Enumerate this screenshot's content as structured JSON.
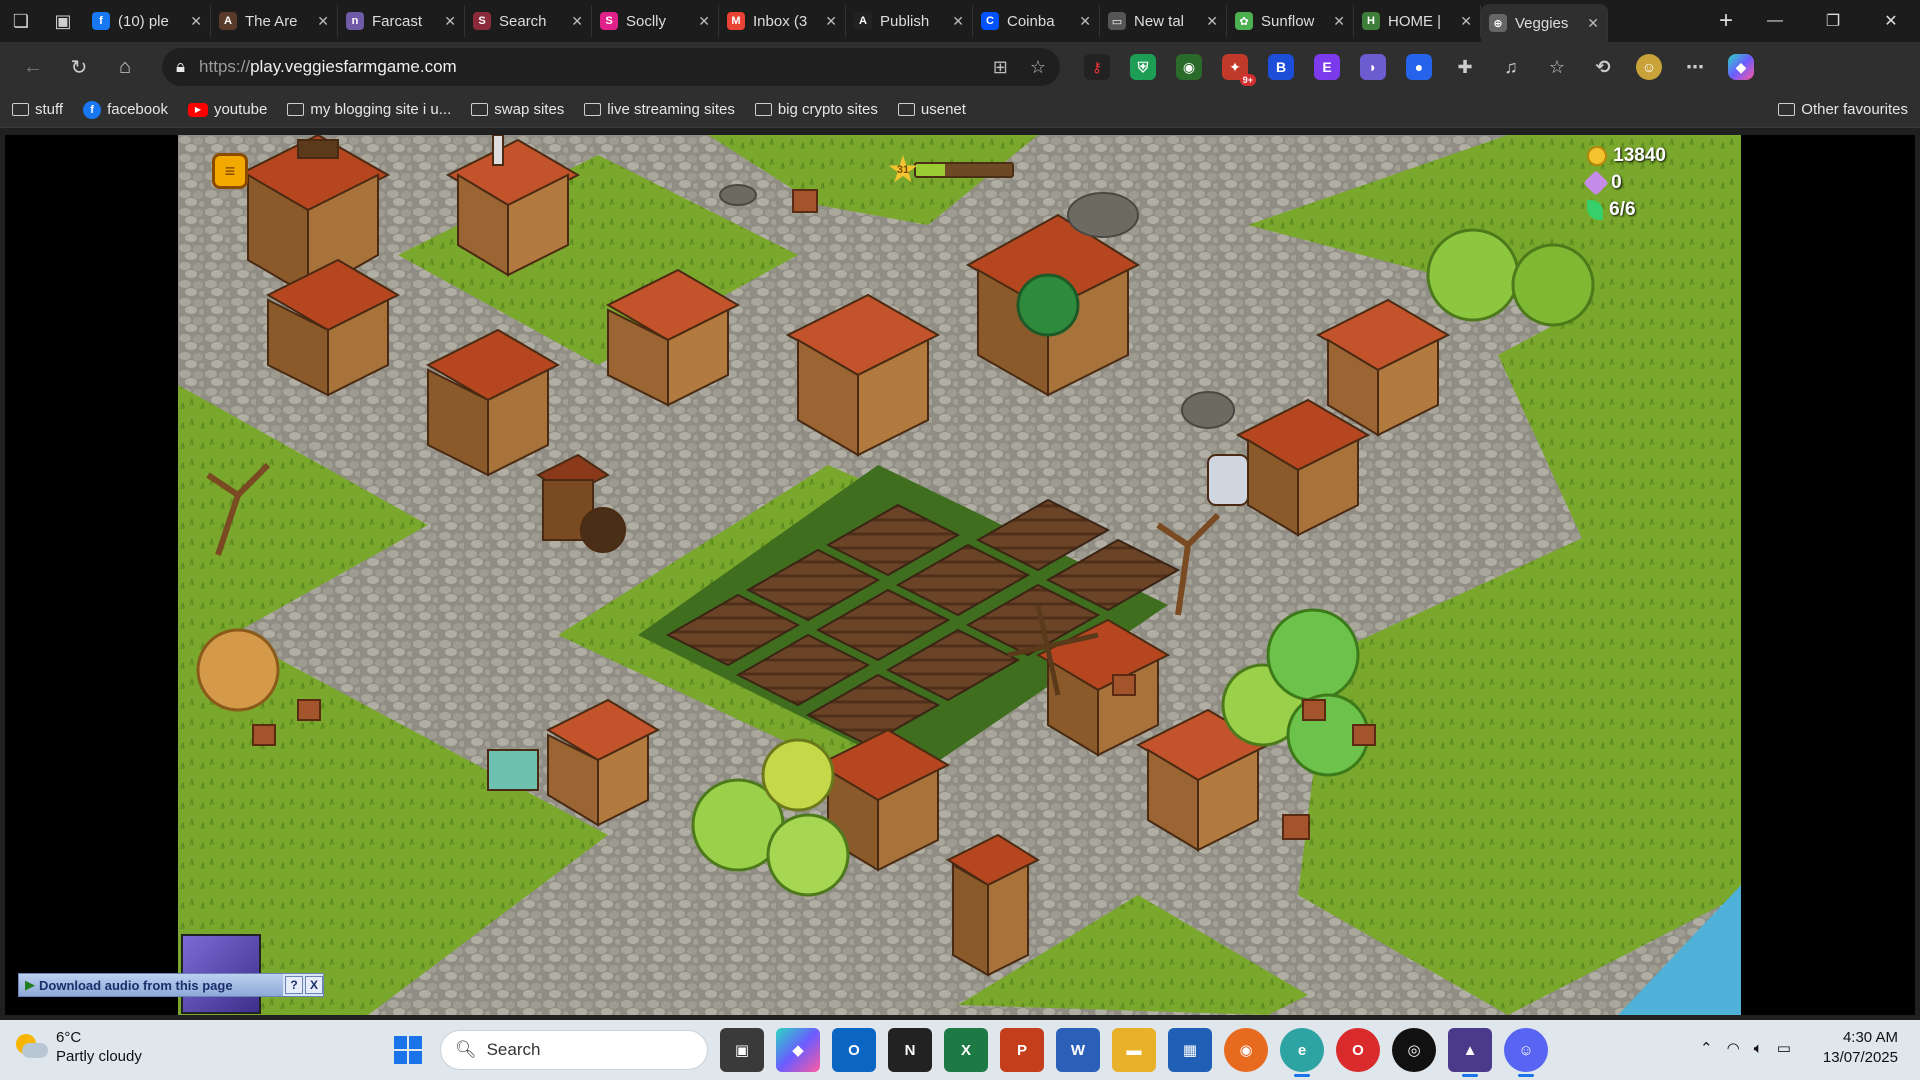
{
  "tabs": [
    {
      "title": "(10) ple",
      "icon": "facebook-icon",
      "color": "#1877f2",
      "glyph": "f"
    },
    {
      "title": "The Are",
      "icon": "arena-icon",
      "color": "#5a3a2a",
      "glyph": "A"
    },
    {
      "title": "Farcast",
      "icon": "farcaster-icon",
      "color": "#6f5ba7",
      "glyph": "n"
    },
    {
      "title": "Search",
      "icon": "search-site-icon",
      "color": "#8a2a3a",
      "glyph": "S"
    },
    {
      "title": "Soclly",
      "icon": "soclly-icon",
      "color": "#e0218a",
      "glyph": "S"
    },
    {
      "title": "Inbox (3",
      "icon": "gmail-icon",
      "color": "#ea4335",
      "glyph": "M"
    },
    {
      "title": "Publish",
      "icon": "publish-icon",
      "color": "#222222",
      "glyph": "A"
    },
    {
      "title": "Coinba",
      "icon": "coinbase-icon",
      "color": "#0052ff",
      "glyph": "C"
    },
    {
      "title": "New tal",
      "icon": "newtab-icon",
      "color": "#555555",
      "glyph": "▭"
    },
    {
      "title": "Sunflow",
      "icon": "sunflower-icon",
      "color": "#4caf50",
      "glyph": "✿"
    },
    {
      "title": "HOME |",
      "icon": "home-game-icon",
      "color": "#3e7d3a",
      "glyph": "H"
    },
    {
      "title": "Veggies",
      "icon": "globe-icon",
      "color": "#666666",
      "glyph": "⊕",
      "active": true
    }
  ],
  "address": {
    "protocol": "https://",
    "host": "play.veggiesfarmgame.com"
  },
  "extensions_badge": "9+",
  "bookmarks": [
    {
      "label": "stuff",
      "type": "folder"
    },
    {
      "label": "facebook",
      "type": "facebook"
    },
    {
      "label": "youtube",
      "type": "youtube"
    },
    {
      "label": "my blogging site i u...",
      "type": "folder"
    },
    {
      "label": "swap sites",
      "type": "folder"
    },
    {
      "label": "live streaming sites",
      "type": "folder"
    },
    {
      "label": "big crypto sites",
      "type": "folder"
    },
    {
      "label": "usenet",
      "type": "folder"
    }
  ],
  "bookmarks_other": "Other favourites",
  "game": {
    "coins": "13840",
    "gems": "0",
    "energy": "6/6",
    "level": "31",
    "xp_progress": 0.3
  },
  "download_audio": {
    "label": "Download audio from this page",
    "help": "?",
    "close": "X"
  },
  "taskbar": {
    "weather_temp": "6°C",
    "weather_desc": "Partly cloudy",
    "search_placeholder": "Search",
    "time": "4:30 AM",
    "date": "13/07/2025"
  }
}
